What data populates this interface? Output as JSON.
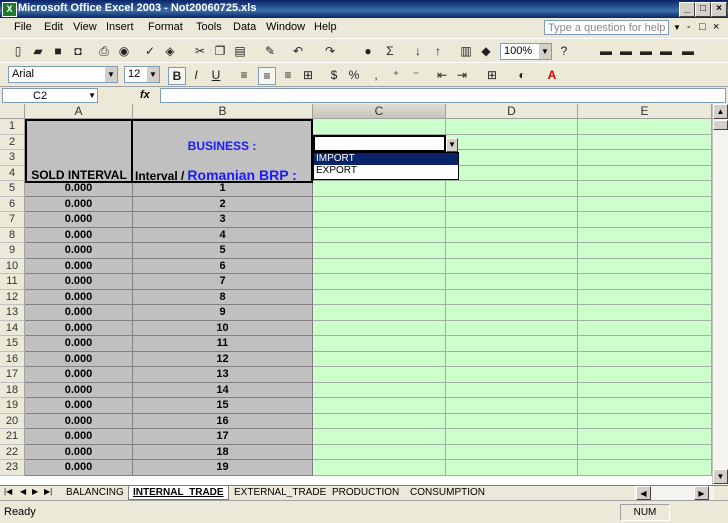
{
  "title": "Microsoft Office Excel 2003 - Not20060725.xls",
  "window_buttons": [
    "_",
    "□",
    "×"
  ],
  "doc_buttons": [
    "-",
    "□",
    "×"
  ],
  "menu": [
    "File",
    "Edit",
    "View",
    "Insert",
    "Format",
    "Tools",
    "Data",
    "Window",
    "Help"
  ],
  "help_placeholder": "Type a question for help",
  "toolbar": {
    "zoom": "100%",
    "font": "Arial",
    "font_size": "12"
  },
  "formula_bar": {
    "name_box": "C2",
    "fx": "fx"
  },
  "columns": [
    "A",
    "B",
    "C",
    "D",
    "E"
  ],
  "rows": [
    "1",
    "2",
    "3",
    "4",
    "5",
    "6",
    "7",
    "8",
    "9",
    "10",
    "11",
    "12",
    "13",
    "14",
    "15",
    "16",
    "17",
    "18",
    "19",
    "20",
    "21",
    "22",
    "23"
  ],
  "header": {
    "business": "BUSINESS :",
    "sold_interval": "SOLD INTERVAL",
    "interval": "Interval /",
    "brp": "Romanian BRP :"
  },
  "dropdown_options": [
    "IMPORT",
    "EXPORT"
  ],
  "sold_values": [
    "0.000",
    "0.000",
    "0.000",
    "0.000",
    "0.000",
    "0.000",
    "0.000",
    "0.000",
    "0.000",
    "0.000",
    "0.000",
    "0.000",
    "0.000",
    "0.000",
    "0.000",
    "0.000",
    "0.000",
    "0.000",
    "0.000"
  ],
  "intervals": [
    "1",
    "2",
    "3",
    "4",
    "5",
    "6",
    "7",
    "8",
    "9",
    "10",
    "11",
    "12",
    "13",
    "14",
    "15",
    "16",
    "17",
    "18",
    "19"
  ],
  "sheets": [
    "BALANCING",
    "INTERNAL_TRADE",
    "EXTERNAL_TRADE",
    "PRODUCTION",
    "CONSUMPTION"
  ],
  "active_sheet": "INTERNAL_TRADE",
  "status": {
    "left": "Ready",
    "num": "NUM"
  },
  "colors": {
    "grid_green": "#ccffcc",
    "header_gray": "#c0c0c0",
    "accent_blue": "#0000ff",
    "title_blue": "#0a246a"
  }
}
